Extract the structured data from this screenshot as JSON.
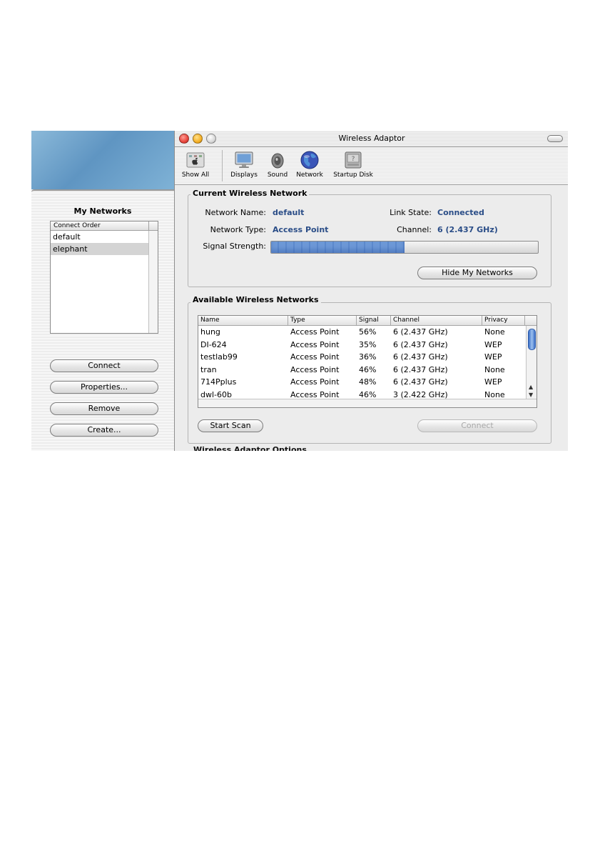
{
  "window": {
    "title": "Wireless Adaptor"
  },
  "toolbar": {
    "items": [
      {
        "label": "Show All",
        "icon": "apple-icon"
      },
      {
        "label": "Displays",
        "icon": "display-icon"
      },
      {
        "label": "Sound",
        "icon": "speaker-icon"
      },
      {
        "label": "Network",
        "icon": "globe-icon"
      },
      {
        "label": "Startup Disk",
        "icon": "disk-icon"
      }
    ]
  },
  "drawer": {
    "title": "My Networks",
    "column_header": "Connect Order",
    "networks": [
      "default",
      "elephant"
    ],
    "selected": "elephant",
    "buttons": {
      "connect": "Connect",
      "properties": "Properties...",
      "remove": "Remove",
      "create": "Create..."
    }
  },
  "current": {
    "group_label": "Current Wireless Network",
    "network_name_label": "Network Name:",
    "network_name": "default",
    "network_type_label": "Network Type:",
    "network_type": "Access Point",
    "link_state_label": "Link State:",
    "link_state": "Connected",
    "channel_label": "Channel:",
    "channel": "6 (2.437 GHz)",
    "signal_label": "Signal Strength:",
    "signal_fraction": 0.5,
    "hide_button": "Hide My Networks"
  },
  "available": {
    "group_label": "Available Wireless Networks",
    "columns": [
      "Name",
      "Type",
      "Signal",
      "Channel",
      "Privacy"
    ],
    "rows": [
      [
        "hung",
        "Access Point",
        "56%",
        "6 (2.437 GHz)",
        "None"
      ],
      [
        "DI-624",
        "Access Point",
        "35%",
        "6 (2.437 GHz)",
        "WEP"
      ],
      [
        "testlab99",
        "Access Point",
        "36%",
        "6 (2.437 GHz)",
        "WEP"
      ],
      [
        "tran",
        "Access Point",
        "46%",
        "6 (2.437 GHz)",
        "None"
      ],
      [
        "714Pplus",
        "Access Point",
        "48%",
        "6 (2.437 GHz)",
        "WEP"
      ],
      [
        "dwl-60b",
        "Access Point",
        "46%",
        "3 (2.422 GHz)",
        "None"
      ]
    ],
    "start_scan": "Start Scan",
    "connect": "Connect"
  },
  "footer_peek": "Wireless Adaptor Options",
  "colors": {
    "value_text": "#2a4d87",
    "close": "#e8453c",
    "minimize": "#f5b026",
    "zoom": "#d8d8d8"
  }
}
